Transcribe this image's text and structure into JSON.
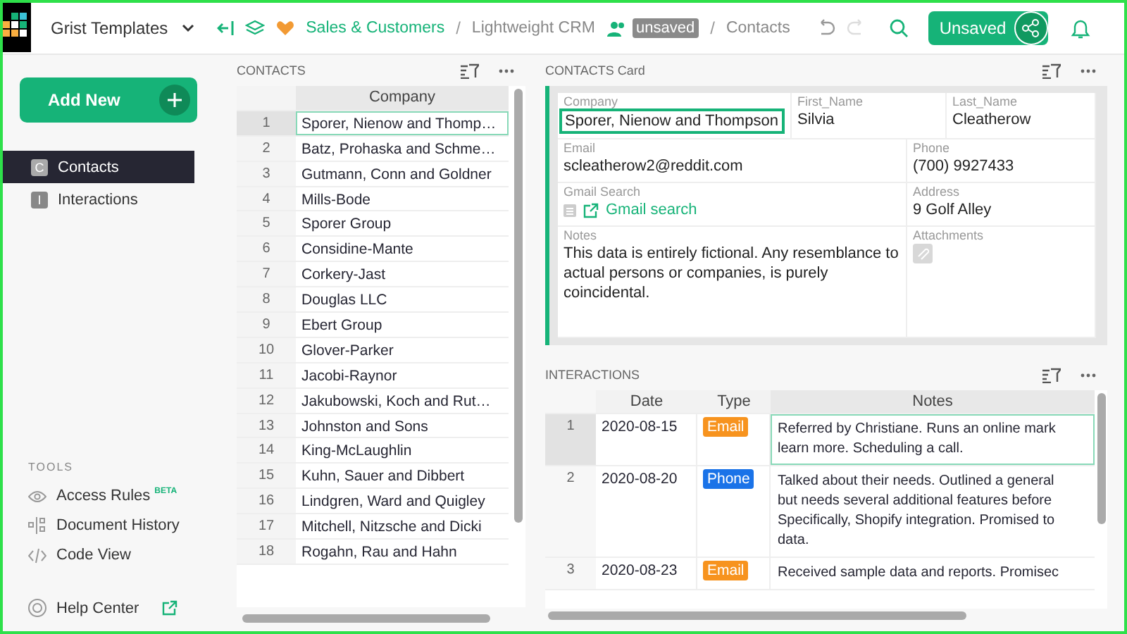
{
  "topbar": {
    "org": "Grist Templates",
    "breadcrumb": {
      "workspace": "Sales & Customers",
      "separators": [
        "/",
        "/"
      ],
      "doc": "Lightweight CRM",
      "badge": "unsaved",
      "page": "Contacts"
    },
    "save_button": "Unsaved",
    "redo_disabled": true
  },
  "sidebar": {
    "add_new": "Add New",
    "pages": [
      {
        "initial": "C",
        "label": "Contacts",
        "selected": true
      },
      {
        "initial": "I",
        "label": "Interactions",
        "selected": false
      }
    ],
    "tools_heading": "TOOLS",
    "tools": [
      {
        "kind": "access",
        "label": "Access Rules",
        "tag": "BETA"
      },
      {
        "kind": "history",
        "label": "Document History"
      },
      {
        "kind": "code",
        "label": "Code View"
      }
    ],
    "help": "Help Center"
  },
  "contacts": {
    "title": "CONTACTS",
    "column": "Company",
    "rows": [
      {
        "n": "1",
        "company": "Sporer, Nienow and Thomp…",
        "selected": true
      },
      {
        "n": "2",
        "company": "Batz, Prohaska and Schme…",
        "selected": false
      },
      {
        "n": "3",
        "company": "Gutmann, Conn and Goldner",
        "selected": false
      },
      {
        "n": "4",
        "company": "Mills-Bode",
        "selected": false
      },
      {
        "n": "5",
        "company": "Sporer Group",
        "selected": false
      },
      {
        "n": "6",
        "company": "Considine-Mante",
        "selected": false
      },
      {
        "n": "7",
        "company": "Corkery-Jast",
        "selected": false
      },
      {
        "n": "8",
        "company": "Douglas LLC",
        "selected": false
      },
      {
        "n": "9",
        "company": "Ebert Group",
        "selected": false
      },
      {
        "n": "10",
        "company": "Glover-Parker",
        "selected": false
      },
      {
        "n": "11",
        "company": "Jacobi-Raynor",
        "selected": false
      },
      {
        "n": "12",
        "company": "Jakubowski, Koch and Rut…",
        "selected": false
      },
      {
        "n": "13",
        "company": "Johnston and Sons",
        "selected": false
      },
      {
        "n": "14",
        "company": "King-McLaughlin",
        "selected": false
      },
      {
        "n": "15",
        "company": "Kuhn, Sauer and Dibbert",
        "selected": false
      },
      {
        "n": "16",
        "company": "Lindgren, Ward and Quigley",
        "selected": false
      },
      {
        "n": "17",
        "company": "Mitchell, Nitzsche and Dicki",
        "selected": false
      },
      {
        "n": "18",
        "company": "Rogahn, Rau and Hahn",
        "selected": false
      }
    ]
  },
  "card": {
    "title": "CONTACTS Card",
    "rows": [
      [
        {
          "kind": "text",
          "label": "Company",
          "value": "Sporer, Nienow and Thompson",
          "selected": true
        },
        {
          "kind": "text",
          "label": "First_Name",
          "value": "Silvia",
          "selected": false
        },
        {
          "kind": "text",
          "label": "Last_Name",
          "value": "Cleatherow",
          "selected": false
        }
      ],
      [
        {
          "kind": "text",
          "label": "Email",
          "value": "scleatherow2@reddit.com",
          "selected": false
        },
        {
          "kind": "text",
          "label": "Phone",
          "value": "(700) 9927433",
          "selected": false
        }
      ],
      [
        {
          "kind": "link",
          "label": "Gmail Search",
          "value": "Gmail search",
          "selected": false
        },
        {
          "kind": "text",
          "label": "Address",
          "value": "9 Golf Alley",
          "selected": false
        }
      ],
      [
        {
          "kind": "text",
          "label": "Notes",
          "value": "This data is entirely fictional. Any resemblance to actual persons or companies, is purely coincidental.",
          "selected": false
        },
        {
          "kind": "attachments",
          "label": "Attachments",
          "selected": false
        }
      ]
    ]
  },
  "interactions": {
    "title": "INTERACTIONS",
    "columns": [
      "Date",
      "Type",
      "Notes"
    ],
    "rows": [
      {
        "n": "1",
        "date": "2020-08-15",
        "type": "Email",
        "color": "#f7931e",
        "notes": [
          "Referred by Christiane. Runs an online mark",
          "learn more. Scheduling a call."
        ],
        "selected": true
      },
      {
        "n": "2",
        "date": "2020-08-20",
        "type": "Phone",
        "color": "#1a73e8",
        "notes": [
          "Talked about their needs. Outlined a general",
          "but needs several additional features before",
          "Specifically, Shopify integration. Promised to",
          "data."
        ],
        "selected": false
      },
      {
        "n": "3",
        "date": "2020-08-23",
        "type": "Email",
        "color": "#f7931e",
        "notes": [
          "Received sample data and reports. Promisec"
        ],
        "selected": false
      }
    ]
  }
}
